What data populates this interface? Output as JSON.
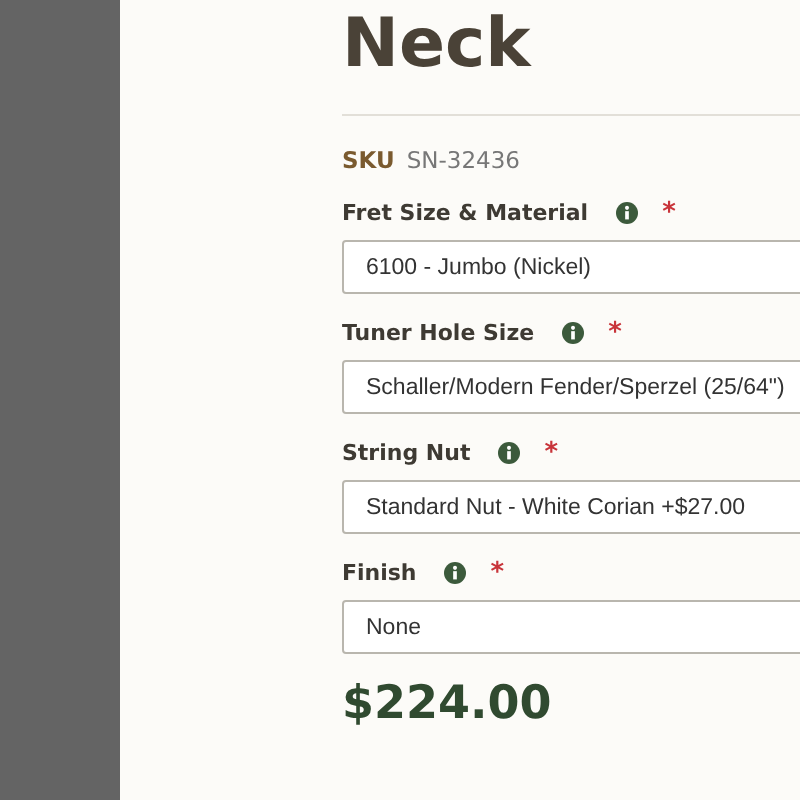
{
  "title": "Neck",
  "sku": {
    "label": "SKU",
    "value": "SN-32436"
  },
  "options": [
    {
      "label": "Fret Size & Material",
      "required_mark": "*",
      "value": "6100 - Jumbo (Nickel)"
    },
    {
      "label": "Tuner Hole Size",
      "required_mark": "*",
      "value": "Schaller/Modern Fender/Sperzel (25/64\")"
    },
    {
      "label": "String Nut",
      "required_mark": "*",
      "value": "Standard Nut - White Corian +$27.00"
    },
    {
      "label": "Finish",
      "required_mark": "*",
      "value": "None"
    }
  ],
  "price": "$224.00"
}
